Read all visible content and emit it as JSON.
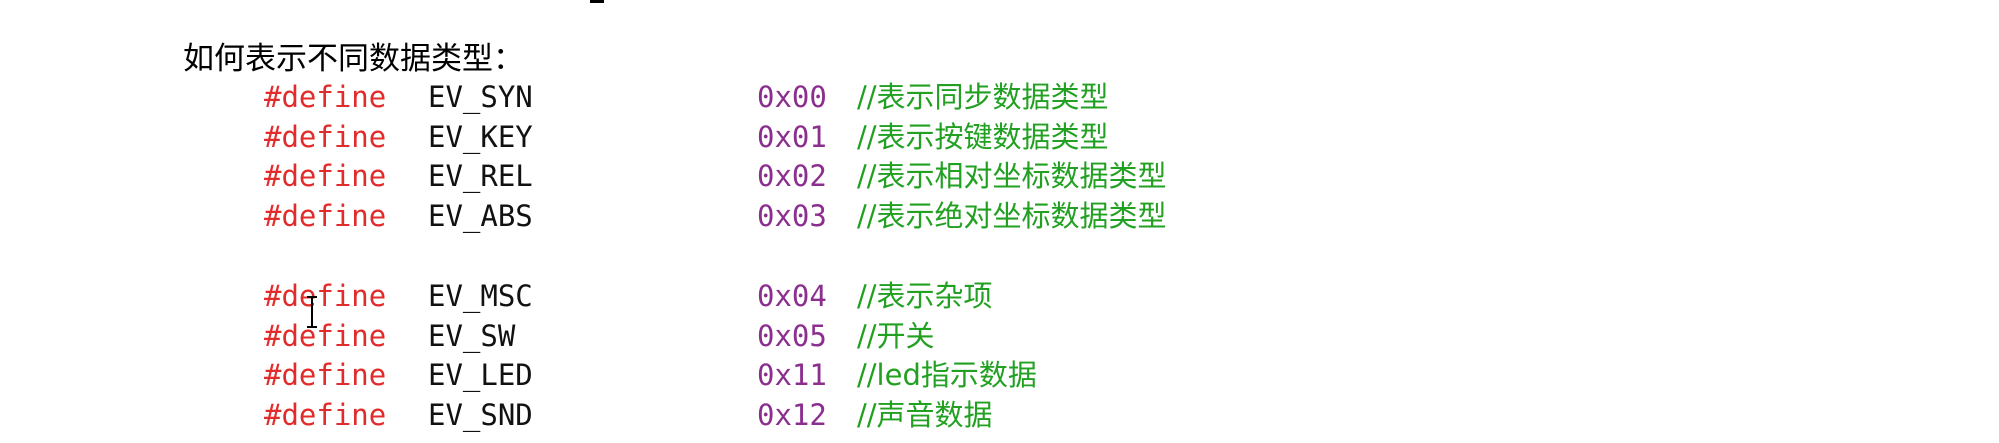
{
  "heading": "如何表示不同数据类型：",
  "lines": [
    {
      "keyword": "#define",
      "name": "EV_SYN",
      "value": "0x00",
      "comment": "//表示同步数据类型"
    },
    {
      "keyword": "#define",
      "name": "EV_KEY",
      "value": "0x01",
      "comment": "//表示按键数据类型"
    },
    {
      "keyword": "#define",
      "name": "EV_REL",
      "value": "0x02",
      "comment": "//表示相对坐标数据类型"
    },
    {
      "keyword": "#define",
      "name": "EV_ABS",
      "value": "0x03",
      "comment": "//表示绝对坐标数据类型"
    },
    {
      "keyword": "#define",
      "name": "EV_MSC",
      "value": "0x04",
      "comment": "//表示杂项"
    },
    {
      "keyword": "#define",
      "name": "EV_SW",
      "value": "0x05",
      "comment": "//开关"
    },
    {
      "keyword": "#define",
      "name": "EV_LED",
      "value": "0x11",
      "comment": "//led指示数据"
    },
    {
      "keyword": "#define",
      "name": "EV_SND",
      "value": "0x12",
      "comment": "//声音数据"
    }
  ],
  "colors": {
    "keyword": "#e22b2b",
    "name": "#111111",
    "value": "#8b2f8f",
    "comment": "#22a022"
  },
  "icons": {
    "cursor": "text-cursor-icon"
  }
}
